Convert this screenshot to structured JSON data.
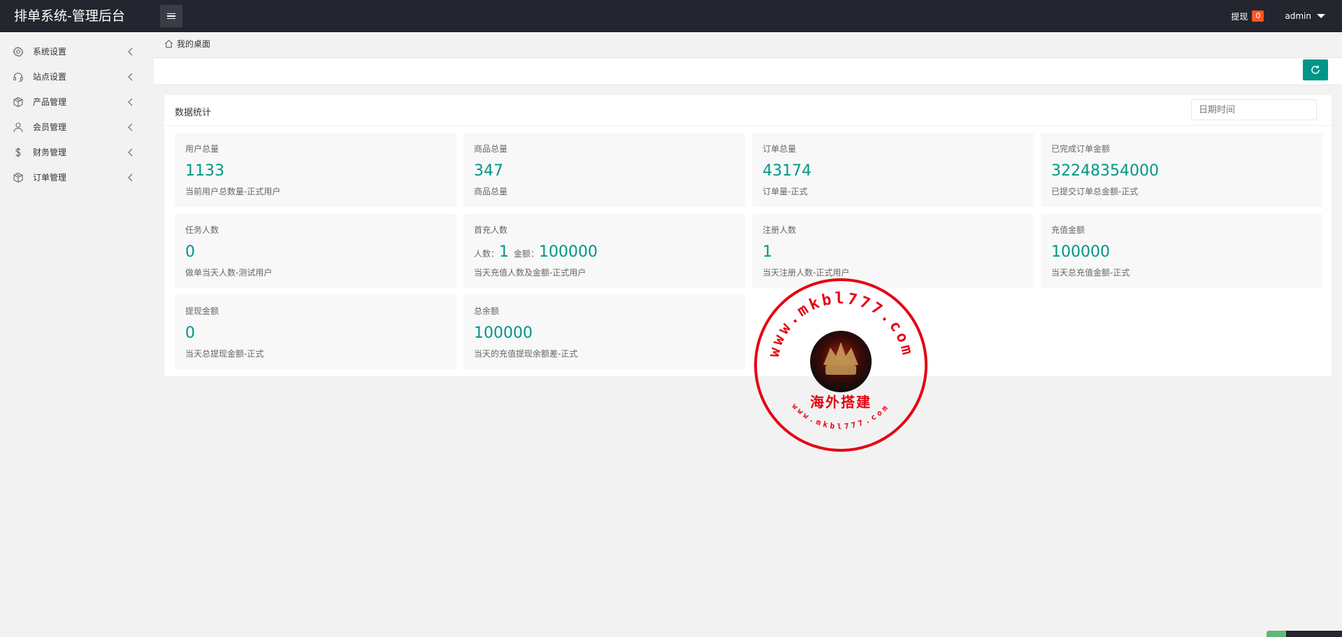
{
  "header": {
    "logo": "排单系统-管理后台",
    "withdraw_label": "提现",
    "withdraw_count": "0",
    "user": "admin"
  },
  "sidebar": {
    "items": [
      {
        "label": "系统设置",
        "icon": "gear-icon"
      },
      {
        "label": "站点设置",
        "icon": "headset-icon"
      },
      {
        "label": "产品管理",
        "icon": "box-icon"
      },
      {
        "label": "会员管理",
        "icon": "user-icon"
      },
      {
        "label": "财务管理",
        "icon": "dollar-icon"
      },
      {
        "label": "订单管理",
        "icon": "box-icon"
      }
    ]
  },
  "breadcrumb": {
    "label": "我的桌面",
    "icon": "home-icon"
  },
  "panel": {
    "title": "数据统计",
    "date_placeholder": "日期时间"
  },
  "cards": [
    {
      "title": "用户总量",
      "value": "1133",
      "desc": "当前用户总数量-正式用户"
    },
    {
      "title": "商品总量",
      "value": "347",
      "desc": "商品总量"
    },
    {
      "title": "订单总量",
      "value": "43174",
      "desc": "订单量-正式"
    },
    {
      "title": "已完成订单金额",
      "value": "32248354000",
      "desc": "已提交订单总金额-正式"
    },
    {
      "title": "任务人数",
      "value": "0",
      "desc": "做单当天人数-测试用户"
    },
    {
      "title": "首充人数",
      "people_label": "人数：",
      "people": "1",
      "amount_label": "金额：",
      "amount": "100000",
      "desc": "当天充值人数及金额-正式用户"
    },
    {
      "title": "注册人数",
      "value": "1",
      "desc": "当天注册人数-正式用户"
    },
    {
      "title": "充值金额",
      "value": "100000",
      "desc": "当天总充值金额-正式"
    },
    {
      "title": "提现金额",
      "value": "0",
      "desc": "当天总提现金额-正式"
    },
    {
      "title": "总余额",
      "value": "100000",
      "desc": "当天的充值提现余额差-正式"
    }
  ],
  "watermark": {
    "url_top": "www.mkbl777.com",
    "text": "海外搭建",
    "url_bottom": "www.mkbl777.com"
  },
  "colors": {
    "accent": "#009688",
    "badge": "#ff5722",
    "header": "#23262e",
    "stamp": "#e60012"
  }
}
